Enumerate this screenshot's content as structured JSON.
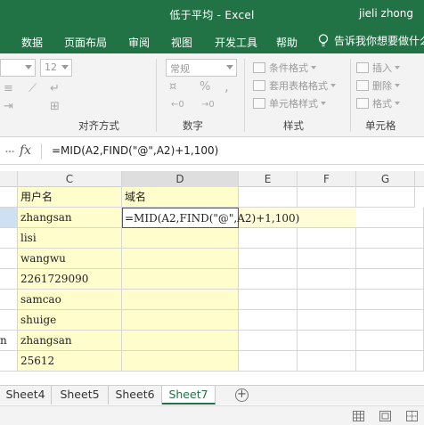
{
  "titlebar": {
    "title": "低于平均 - Excel",
    "user": "jieli zhong"
  },
  "ribbon_tabs": [
    "数据",
    "页面布局",
    "审阅",
    "视图",
    "开发工具",
    "帮助"
  ],
  "tell_me": "告诉我你想要做什么",
  "ribbon": {
    "font_size": "12",
    "number_format": "常规",
    "groups": [
      "对齐方式",
      "数字",
      "样式",
      "单元格"
    ],
    "styles_buttons": [
      "条件格式",
      "套用表格格式",
      "单元格样式"
    ],
    "cells_buttons": [
      "插入",
      "删除",
      "格式"
    ],
    "percent": "%",
    "comma": ","
  },
  "formula_bar": {
    "fx": "fx",
    "formula": "=MID(A2,FIND(\"@\",A2)+1,100)"
  },
  "columns": [
    "C",
    "D",
    "E",
    "F",
    "G"
  ],
  "cells": {
    "c1": "用户名",
    "d1": "域名",
    "c2": "zhangsan",
    "d2": "=MID(A2,FIND(\"@\",A2)+1,100)",
    "c3": "lisi",
    "c4": "wangwu",
    "c5": "2261729090",
    "c6": "samcao",
    "c7": "shuige",
    "b8": "n",
    "c8": "zhangsan",
    "c9": "25612"
  },
  "sheets": [
    "Sheet4",
    "Sheet5",
    "Sheet6",
    "Sheet7"
  ],
  "active_sheet": "Sheet7",
  "add_sheet": "+",
  "colors": {
    "excel_green": "#217346",
    "highlight_yellow": "#fffdcc"
  }
}
